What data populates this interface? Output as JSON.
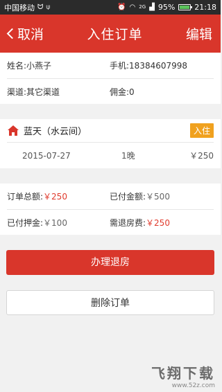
{
  "status_bar": {
    "carrier": "中国移动",
    "battery": "95%",
    "time": "21:18",
    "signal_label": "2G"
  },
  "nav": {
    "back_label": "取消",
    "title": "入住订单",
    "edit_label": "编辑"
  },
  "guest": {
    "name": "姓名:小燕子",
    "phone": "手机:18384607998",
    "channel": "渠道:其它渠道",
    "commission": "佣金:0"
  },
  "room": {
    "name": "蓝天（水云间）",
    "status_badge": "入住",
    "date": "2015-07-27",
    "nights": "1晚",
    "price": "￥250"
  },
  "payment": {
    "total_label": "订单总额:",
    "total_value": "￥250",
    "paid_label": "已付金额:",
    "paid_value": "￥500",
    "deposit_label": "已付押金:",
    "deposit_value": "￥100",
    "refund_label": "需退房费:",
    "refund_value": "￥250"
  },
  "actions": {
    "checkout_label": "办理退房",
    "delete_label": "删除订单"
  },
  "watermark": {
    "title": "飞翔下载",
    "url": "www.52z.com"
  },
  "colors": {
    "brand_red": "#d9362b",
    "badge_orange": "#f0a11f",
    "amount_red": "#e03a2c"
  }
}
